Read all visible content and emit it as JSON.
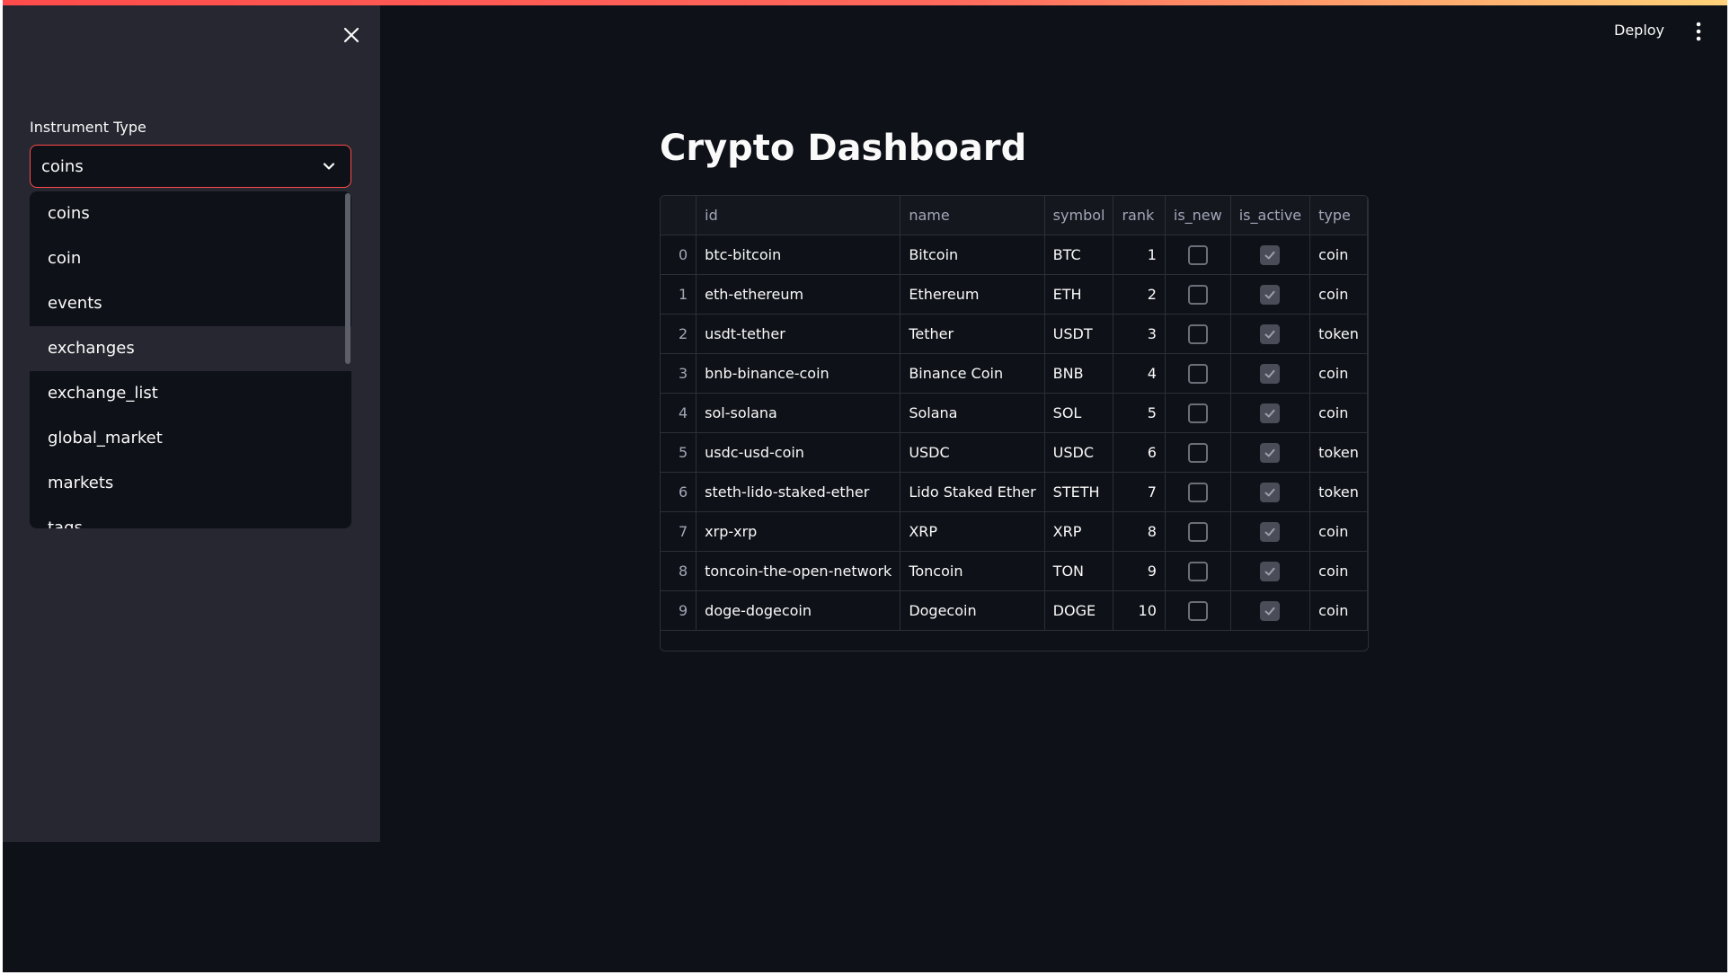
{
  "sidebar": {
    "close_icon": "close-icon",
    "select_label": "Instrument Type",
    "select_value": "coins",
    "options": [
      "coins",
      "coin",
      "events",
      "exchanges",
      "exchange_list",
      "global_market",
      "markets",
      "tags"
    ],
    "highlighted_option": "exchanges"
  },
  "header": {
    "deploy_label": "Deploy",
    "menu_icon": "more-vertical-icon"
  },
  "main": {
    "title": "Crypto Dashboard",
    "table": {
      "columns": [
        "",
        "id",
        "name",
        "symbol",
        "rank",
        "is_new",
        "is_active",
        "type"
      ],
      "rows": [
        {
          "index": "0",
          "id": "btc-bitcoin",
          "name": "Bitcoin",
          "symbol": "BTC",
          "rank": "1",
          "is_new": false,
          "is_active": true,
          "type": "coin"
        },
        {
          "index": "1",
          "id": "eth-ethereum",
          "name": "Ethereum",
          "symbol": "ETH",
          "rank": "2",
          "is_new": false,
          "is_active": true,
          "type": "coin"
        },
        {
          "index": "2",
          "id": "usdt-tether",
          "name": "Tether",
          "symbol": "USDT",
          "rank": "3",
          "is_new": false,
          "is_active": true,
          "type": "token"
        },
        {
          "index": "3",
          "id": "bnb-binance-coin",
          "name": "Binance Coin",
          "symbol": "BNB",
          "rank": "4",
          "is_new": false,
          "is_active": true,
          "type": "coin"
        },
        {
          "index": "4",
          "id": "sol-solana",
          "name": "Solana",
          "symbol": "SOL",
          "rank": "5",
          "is_new": false,
          "is_active": true,
          "type": "coin"
        },
        {
          "index": "5",
          "id": "usdc-usd-coin",
          "name": "USDC",
          "symbol": "USDC",
          "rank": "6",
          "is_new": false,
          "is_active": true,
          "type": "token"
        },
        {
          "index": "6",
          "id": "steth-lido-staked-ether",
          "name": "Lido Staked Ether",
          "symbol": "STETH",
          "rank": "7",
          "is_new": false,
          "is_active": true,
          "type": "token"
        },
        {
          "index": "7",
          "id": "xrp-xrp",
          "name": "XRP",
          "symbol": "XRP",
          "rank": "8",
          "is_new": false,
          "is_active": true,
          "type": "coin"
        },
        {
          "index": "8",
          "id": "toncoin-the-open-network",
          "name": "Toncoin",
          "symbol": "TON",
          "rank": "9",
          "is_new": false,
          "is_active": true,
          "type": "coin"
        },
        {
          "index": "9",
          "id": "doge-dogecoin",
          "name": "Dogecoin",
          "symbol": "DOGE",
          "rank": "10",
          "is_new": false,
          "is_active": true,
          "type": "coin"
        }
      ]
    }
  },
  "colors": {
    "background": "#0e1117",
    "sidebar": "#262730",
    "accent": "#ff4b4b",
    "text": "#fafafa"
  }
}
